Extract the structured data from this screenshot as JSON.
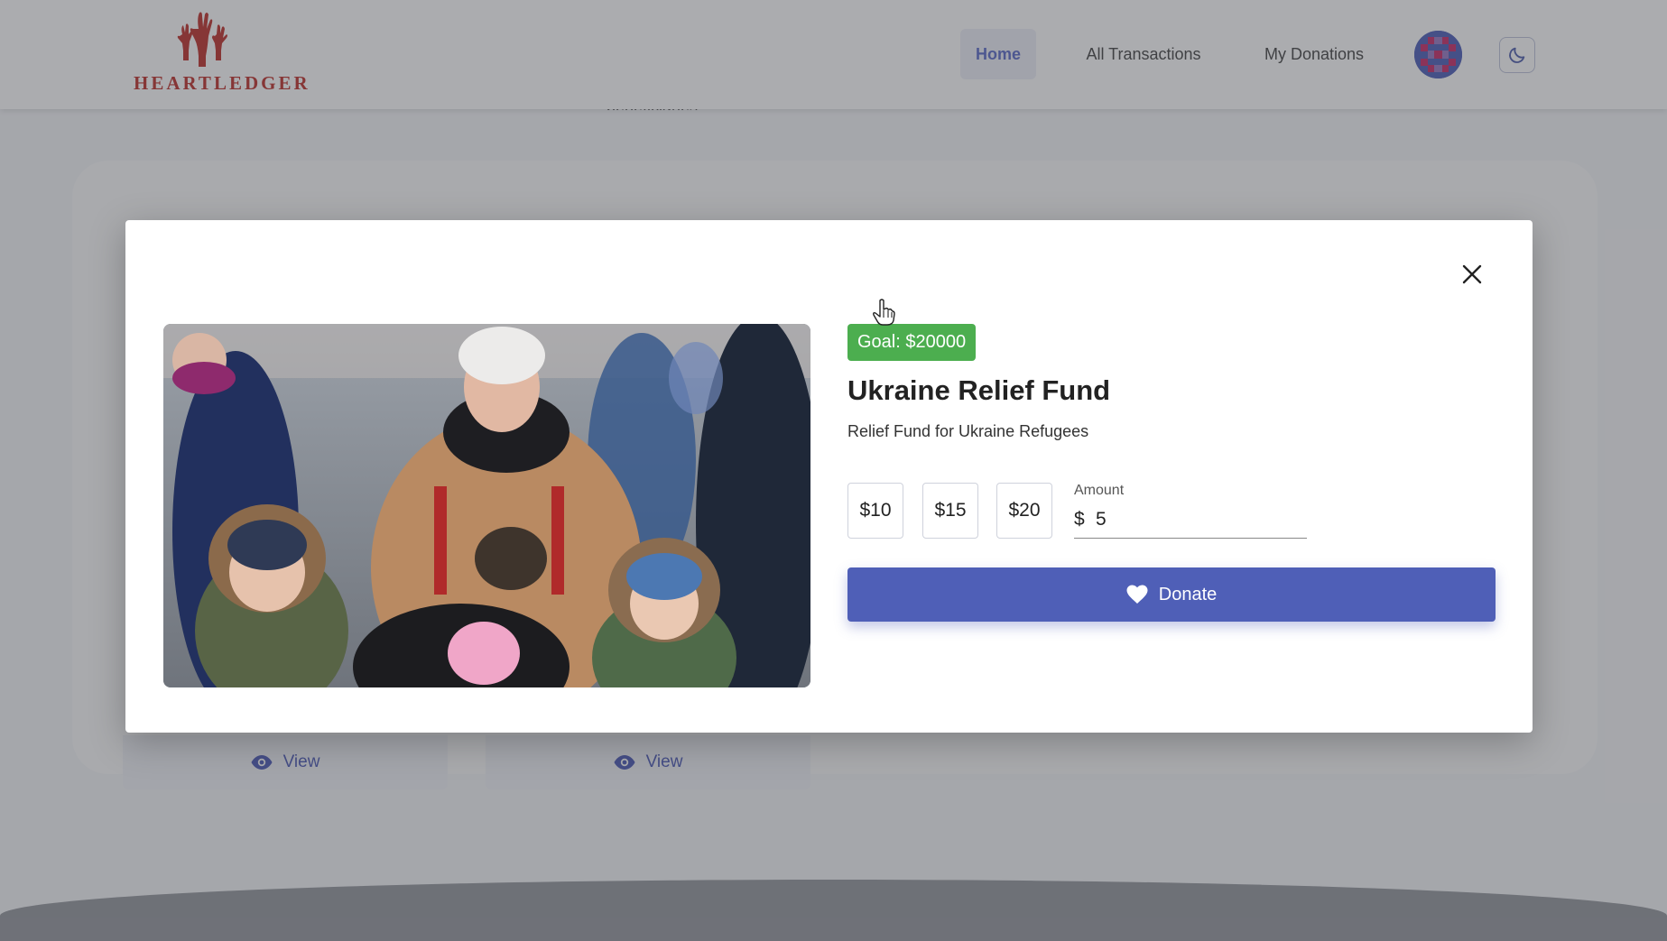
{
  "app": {
    "logo_text": "HEARTLEDGER"
  },
  "nav": {
    "items": [
      {
        "label": "Home",
        "active": true
      },
      {
        "label": "All Transactions",
        "active": false
      },
      {
        "label": "My Donations",
        "active": false
      }
    ]
  },
  "background": {
    "partial_text": "beneficiaries",
    "view_buttons": [
      {
        "label": "View"
      },
      {
        "label": "View"
      }
    ]
  },
  "modal": {
    "goal_label": "Goal: $20000",
    "title": "Ukraine Relief Fund",
    "description": "Relief Fund for Ukraine Refugees",
    "presets": [
      "$10",
      "$15",
      "$20"
    ],
    "amount": {
      "label": "Amount",
      "prefix": "$",
      "value": "5"
    },
    "donate_label": "Donate"
  },
  "icons": {
    "close": "close-icon",
    "theme_toggle": "moon-icon",
    "donate": "heart-icon",
    "view": "eye-icon",
    "cursor": "hand-pointer-icon"
  },
  "colors": {
    "brand_red": "#b81d17",
    "primary": "#4f5fb7",
    "goal_green": "#4cae4f",
    "nav_active_text": "#4b5cc4"
  }
}
